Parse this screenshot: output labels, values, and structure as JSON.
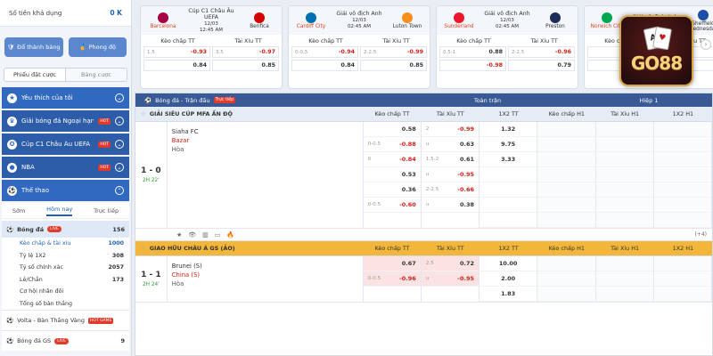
{
  "sidebar": {
    "balance_label": "Số tiền khả dụng",
    "balance_value": "0 K",
    "btn_history": "Đổ thành bảng",
    "btn_promo": "Phong độ",
    "tab_pending": "Phiếu đặt cược",
    "tab_board": "Bảng cược",
    "menu": [
      {
        "label": "Yêu thích của tôi",
        "icon": "star-icon"
      },
      {
        "label": "Giải bóng đá Ngoại hạn...",
        "icon": "premier-league-icon",
        "hot": "HOT"
      },
      {
        "label": "Cúp C1 Châu Âu UEFA",
        "icon": "trophy-icon",
        "hot": "HOT"
      },
      {
        "label": "NBA",
        "icon": "basketball-icon",
        "hot": "HOT"
      },
      {
        "label": "Thể thao",
        "icon": "sports-icon"
      }
    ],
    "subtabs": [
      "Sớm",
      "Hôm nay",
      "Trực tiếp"
    ],
    "sport": {
      "label": "Bóng đá",
      "live": "LIVE",
      "count": "156"
    },
    "markets": [
      {
        "label": "Kèo chấp & tài xỉu",
        "count": "1000"
      },
      {
        "label": "Tỷ lệ 1X2",
        "count": "308"
      },
      {
        "label": "Tỷ số chính xác",
        "count": "2057"
      },
      {
        "label": "Lẻ/Chẵn",
        "count": "173"
      },
      {
        "label": "Cơ hội nhân đôi",
        "count": ""
      },
      {
        "label": "Tổng số bàn thắng",
        "count": ""
      }
    ],
    "volta": {
      "label": "Volta - Bàn Thắng Vàng",
      "badge": "HOT GAME"
    },
    "gs": {
      "label": "Bóng đá GS",
      "live": "LIVE",
      "count": "9"
    }
  },
  "cards": [
    {
      "league": "Cúp C1 Châu Âu UEFA",
      "date": "12/03",
      "time": "12:45 AM",
      "home": "Barcelona",
      "away": "Benfica",
      "home_color": "#a50044",
      "away_color": "#d50000",
      "hcap": [
        {
          "h": "1.5",
          "v": "-0.93"
        },
        {
          "h": "",
          "v": "0.84"
        }
      ],
      "ou": [
        {
          "h": "3.5",
          "v": "-0.97"
        },
        {
          "h": "",
          "v": "0.85"
        }
      ]
    },
    {
      "league": "Giải vô địch Anh",
      "date": "12/03",
      "time": "02:45 AM",
      "home": "Cardiff City",
      "away": "Luton Town",
      "home_color": "#0070b5",
      "away_color": "#f78f1e",
      "hcap": [
        {
          "h": "0-0.5",
          "v": "-0.94"
        },
        {
          "h": "",
          "v": "0.84"
        }
      ],
      "ou": [
        {
          "h": "2-2.5",
          "v": "-0.99"
        },
        {
          "h": "",
          "v": "0.85"
        }
      ]
    },
    {
      "league": "Giải vô địch Anh",
      "date": "12/03",
      "time": "02:45 AM",
      "home": "Sunderland",
      "away": "Preston",
      "home_color": "#eb172b",
      "away_color": "#1c2c5b",
      "hcap": [
        {
          "h": "0.5-1",
          "v": "0.88"
        },
        {
          "h": "",
          "v": "-0.98"
        }
      ],
      "ou": [
        {
          "h": "2-2.5",
          "v": "-0.96"
        },
        {
          "h": "",
          "v": "0.79"
        }
      ]
    },
    {
      "league": "Giải vô địch Anh",
      "date": "12/03",
      "time": "",
      "home": "Norwich City",
      "away": "Sheffield Wednesday",
      "home_color": "#00a650",
      "away_color": "#1e4fa8",
      "hcap": [
        {
          "h": "",
          "v": "0.97"
        },
        {
          "h": "",
          "v": "0.85"
        }
      ],
      "ou": [
        {
          "h": "",
          "v": ""
        },
        {
          "h": "",
          "v": ""
        }
      ]
    }
  ],
  "card_hdr": {
    "hcap": "Kèo chấp TT",
    "ou": "Tài Xỉu TT"
  },
  "logo_text": "GO88",
  "table": {
    "title": "Bóng đá - Trận đấu",
    "live_badge": "Trực tiếp",
    "fulltime": "Toàn trận",
    "half1": "Hiệp 1",
    "cols": [
      "Kèo chấp TT",
      "Tài Xỉu TT",
      "1X2 TT",
      "Kèo chấp H1",
      "Tài Xỉu H1",
      "1X2 H1"
    ],
    "leagues": [
      {
        "name": "GIẢI SIÊU CÚP MFA ẤN ĐỘ",
        "score": "1 - 0",
        "time": "2H 22'",
        "home": "Siaha FC",
        "away": "Bazar",
        "draw": "Hòa",
        "lines": [
          {
            "hc": [
              {
                "h": "",
                "v": "0.58"
              },
              {
                "h": "0-0.5",
                "v": "-0.88"
              }
            ],
            "ou": [
              {
                "h": "2",
                "v": "-0.99"
              },
              {
                "h": "u",
                "v": "0.63"
              }
            ],
            "x12": [
              "1.32",
              "9.75",
              "3.33"
            ]
          },
          {
            "hc": [
              {
                "h": "0",
                "v": "-0.84"
              },
              {
                "h": "",
                "v": "0.53"
              }
            ],
            "ou": [
              {
                "h": "1.5-2",
                "v": "0.61"
              },
              {
                "h": "u",
                "v": "-0.95"
              }
            ],
            "x12": []
          },
          {
            "hc": [
              {
                "h": "",
                "v": "0.36"
              },
              {
                "h": "0-0.5",
                "v": "-0.60"
              }
            ],
            "ou": [
              {
                "h": "2-2.5",
                "v": "-0.66"
              },
              {
                "h": "u",
                "v": "0.38"
              }
            ],
            "x12": []
          }
        ],
        "more": "(+4)"
      },
      {
        "name": "GIAO HỮU CHÂU Á GS (ẢO)",
        "score": "1 - 1",
        "time": "2H 24'",
        "home": "Brunei (S)",
        "away": "China (S)",
        "draw": "Hòa",
        "lines": [
          {
            "hc": [
              {
                "h": "",
                "v": "0.67"
              },
              {
                "h": "0-0.5",
                "v": "-0.96"
              }
            ],
            "ou": [
              {
                "h": "2.5",
                "v": "0.72"
              },
              {
                "h": "u",
                "v": "-0.95"
              }
            ],
            "x12": [
              "10.00",
              "2.00",
              "1.83"
            ]
          }
        ]
      }
    ]
  }
}
